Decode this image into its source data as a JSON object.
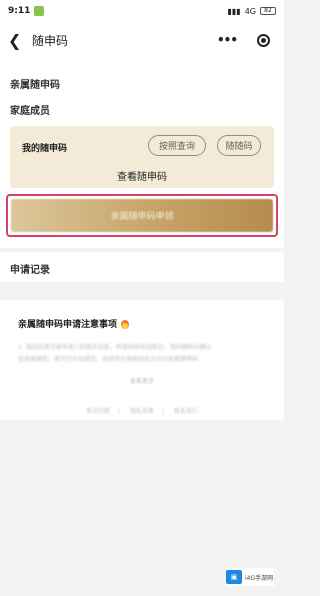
{
  "status_bar": {
    "time": "9:11",
    "network": "4G",
    "battery": "82"
  },
  "nav": {
    "title": "随申码",
    "dots": "•••"
  },
  "section_family_code": "亲属随申码",
  "section_family_members": "家庭成员",
  "card": {
    "label": "我的随申码",
    "btn_proxy_query": "按照查询",
    "btn_member_code": "随随码",
    "view_link": "查看随申码"
  },
  "cta_label": "亲属随申码申领",
  "section_records": "申请记录",
  "notes": {
    "title": "亲属随申码申请注意事项",
    "line1": "1. 请如实填写被申请人的真实信息，申请后将自动提交，请仔细核对确认",
    "line2": "信息准确性，填写完毕后提交，系统将在审核后显示对应亲属随申码",
    "more": "查看更多"
  },
  "footer": {
    "link1": "常见问题",
    "link2": "隐私政策",
    "link3": "联系我们"
  },
  "watermark": "i4G手游网",
  "colors": {
    "accent_gold": "#c9a66b",
    "highlight_border": "#d4416a",
    "card_bg": "#f3ead7"
  }
}
